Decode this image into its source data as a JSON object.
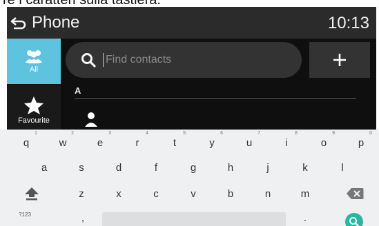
{
  "doc_text": "re i caratteri sulla tastiera.",
  "status_bar": {
    "back_label": "Phone",
    "clock": "10:13"
  },
  "sidebar": {
    "items": [
      {
        "label": "All",
        "icon": "contacts-group-icon",
        "active": true
      },
      {
        "label": "Favourite",
        "icon": "star-icon",
        "active": false
      }
    ]
  },
  "search": {
    "placeholder": "Find contacts",
    "value": ""
  },
  "add_button": {
    "icon": "plus-icon"
  },
  "contacts": {
    "section_letter": "A",
    "rows": [
      {
        "icon": "person-icon"
      }
    ]
  },
  "keyboard": {
    "row1": [
      {
        "key": "q",
        "hint": "1"
      },
      {
        "key": "w",
        "hint": "2"
      },
      {
        "key": "e",
        "hint": "3"
      },
      {
        "key": "r",
        "hint": "4"
      },
      {
        "key": "t",
        "hint": "5"
      },
      {
        "key": "y",
        "hint": "6"
      },
      {
        "key": "u",
        "hint": "7"
      },
      {
        "key": "i",
        "hint": "8"
      },
      {
        "key": "o",
        "hint": "9"
      },
      {
        "key": "p",
        "hint": "0"
      }
    ],
    "row2": [
      "a",
      "s",
      "d",
      "f",
      "g",
      "h",
      "j",
      "k",
      "l"
    ],
    "row3": [
      "z",
      "x",
      "c",
      "v",
      "b",
      "n",
      "m"
    ],
    "row4": {
      "symbols_key": "?123",
      "comma": ",",
      "period": "."
    },
    "icons": {
      "shift": "shift-arrow-icon",
      "backspace": "backspace-icon",
      "search": "search-key-icon"
    },
    "accent_color": "#29b6a2"
  },
  "colors": {
    "sidebar_active": "#5ec3df",
    "screen_bg": "#0f0f0f",
    "status_bar": "#2b2b2b"
  }
}
